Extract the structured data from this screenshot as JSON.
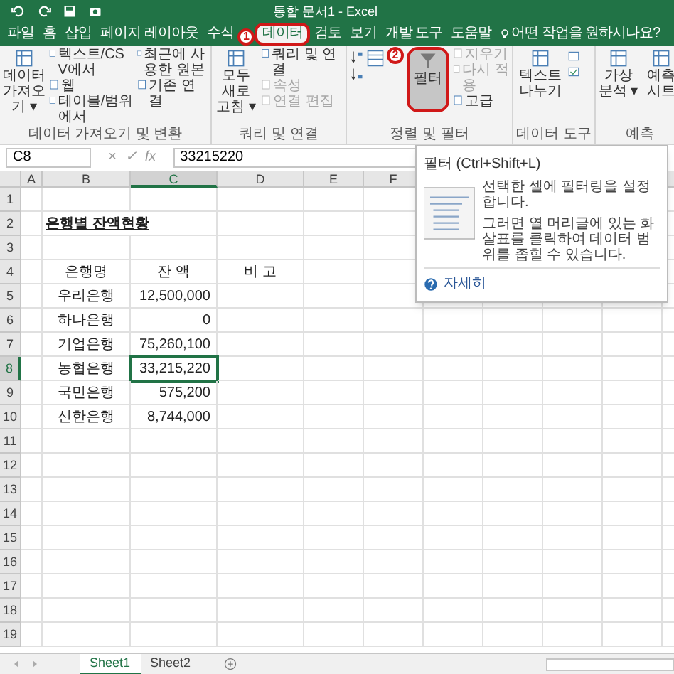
{
  "window": {
    "title": "통합 문서1 - Excel"
  },
  "tabs": [
    {
      "label": "파일",
      "selected": false
    },
    {
      "label": "홈",
      "selected": false
    },
    {
      "label": "삽입",
      "selected": false
    },
    {
      "label": "페이지 레이아웃",
      "selected": false
    },
    {
      "label": "수식",
      "selected": false
    },
    {
      "label": "데이터",
      "selected": true,
      "circled": true,
      "marker": "1"
    },
    {
      "label": "검토",
      "selected": false
    },
    {
      "label": "보기",
      "selected": false
    },
    {
      "label": "개발 도구",
      "selected": false
    },
    {
      "label": "도움말",
      "selected": false
    }
  ],
  "tell_me": {
    "placeholder": "어떤 작업을 원하시나요?"
  },
  "ribbon_groups": [
    {
      "label": "데이터 가져오기 및 변환",
      "buttons": [
        {
          "kind": "large",
          "label": "데이터 가져오기 ▾",
          "disabled": false
        },
        {
          "kind": "small",
          "label": "텍스트/CSV에서",
          "disabled": false
        },
        {
          "kind": "small",
          "label": "웹",
          "disabled": false
        },
        {
          "kind": "small",
          "label": "테이블/범위에서",
          "disabled": false
        },
        {
          "kind": "small",
          "label": "최근에 사용한 원본",
          "disabled": false
        },
        {
          "kind": "small",
          "label": "기존 연결",
          "disabled": false
        }
      ]
    },
    {
      "label": "쿼리 및 연결",
      "buttons": [
        {
          "kind": "large",
          "label": "모두 새로 고침 ▾",
          "disabled": false
        },
        {
          "kind": "small",
          "label": "쿼리 및 연결",
          "disabled": false
        },
        {
          "kind": "small",
          "label": "속성",
          "disabled": true
        },
        {
          "kind": "small",
          "label": "연결 편집",
          "disabled": true
        }
      ]
    },
    {
      "label": "정렬 및 필터",
      "buttons": [
        {
          "kind": "sort"
        },
        {
          "kind": "large",
          "label": "필터",
          "disabled": false,
          "circled": true,
          "marker": "2"
        },
        {
          "kind": "small",
          "label": "지우기",
          "disabled": true
        },
        {
          "kind": "small",
          "label": "다시 적용",
          "disabled": true
        },
        {
          "kind": "small",
          "label": "고급",
          "disabled": false
        }
      ]
    },
    {
      "label": "데이터 도구",
      "buttons": [
        {
          "kind": "large",
          "label": "텍스트 나누기",
          "disabled": false
        },
        {
          "kind": "tools"
        }
      ]
    },
    {
      "label": "예측",
      "buttons": [
        {
          "kind": "large",
          "label": "가상 분석 ▾",
          "disabled": false
        },
        {
          "kind": "large",
          "label": "예측 시트",
          "disabled": false
        }
      ]
    }
  ],
  "formula_bar": {
    "name_box": "C8",
    "icons": [
      "×",
      "✓",
      "fx"
    ],
    "value": "33215220"
  },
  "columns": [
    {
      "label": "A",
      "selected": false
    },
    {
      "label": "B",
      "selected": false
    },
    {
      "label": "C",
      "selected": true
    },
    {
      "label": "D",
      "selected": false
    },
    {
      "label": "E",
      "selected": false
    },
    {
      "label": "F",
      "selected": false
    }
  ],
  "rows": [
    {
      "number": "1",
      "selected": false
    },
    {
      "number": "2",
      "selected": false,
      "kind": "title",
      "B": "은행별 잔액현황"
    },
    {
      "number": "3",
      "selected": false
    },
    {
      "number": "4",
      "selected": false,
      "kind": "header",
      "B": "은행명",
      "C": "잔 액",
      "D": "비 고"
    },
    {
      "number": "5",
      "selected": false,
      "kind": "data",
      "B": "우리은행",
      "C": "12,500,000"
    },
    {
      "number": "6",
      "selected": false,
      "kind": "data",
      "B": "하나은행",
      "C": "0"
    },
    {
      "number": "7",
      "selected": false,
      "kind": "data",
      "B": "기업은행",
      "C": "75,260,100"
    },
    {
      "number": "8",
      "selected": true,
      "kind": "data",
      "B": "농협은행",
      "C": "33,215,220"
    },
    {
      "number": "9",
      "selected": false,
      "kind": "data",
      "B": "국민은행",
      "C": "575,200"
    },
    {
      "number": "10",
      "selected": false,
      "kind": "data",
      "B": "신한은행",
      "C": "8,744,000"
    },
    {
      "number": "11",
      "selected": false
    },
    {
      "number": "12",
      "selected": false
    },
    {
      "number": "13",
      "selected": false
    },
    {
      "number": "14",
      "selected": false
    },
    {
      "number": "15",
      "selected": false
    },
    {
      "number": "16",
      "selected": false
    },
    {
      "number": "17",
      "selected": false
    },
    {
      "number": "18",
      "selected": false
    },
    {
      "number": "19",
      "selected": false
    }
  ],
  "tooltip": {
    "title": "필터 (Ctrl+Shift+L)",
    "lines": [
      "선택한 셀에 필터링을 설정합니다.",
      "그러면 열 머리글에 있는 화살표를 클릭하여 데이터 범위를 좁힐 수 있습니다."
    ],
    "link": "자세히"
  },
  "sheet_tabs": [
    {
      "label": "Sheet1",
      "selected": true
    },
    {
      "label": "Sheet2",
      "selected": false
    }
  ]
}
